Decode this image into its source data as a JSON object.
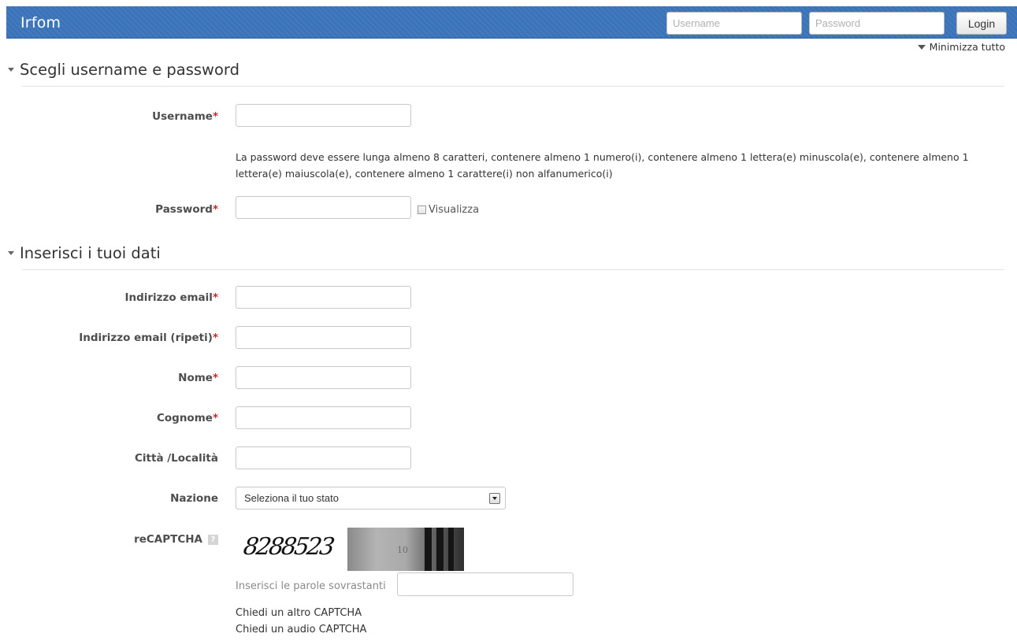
{
  "navbar": {
    "brand": "Irfom",
    "username_placeholder": "Username",
    "password_placeholder": "Password",
    "login_label": "Login",
    "accent_color": "#3b73b9"
  },
  "collapse_all_label": "Minimizza tutto",
  "sections": {
    "account": {
      "title": "Scegli username e password",
      "username_label": "Username",
      "password_help": "La password deve essere lunga almeno 8 caratteri, contenere almeno 1 numero(i), contenere almeno 1 lettera(e) minuscola(e), contenere almeno 1 lettera(e) maiuscola(e), contenere almeno 1 carattere(i) non alfanumerico(i)",
      "password_label": "Password",
      "show_password_label": "Visualizza"
    },
    "details": {
      "title": "Inserisci i tuoi dati",
      "email_label": "Indirizzo email",
      "email_repeat_label": "Indirizzo email (ripeti)",
      "firstname_label": "Nome",
      "lastname_label": "Cognome",
      "city_label": "Città /Località",
      "country_label": "Nazione",
      "country_selected": "Seleziona il tuo stato",
      "recaptcha_label": "reCAPTCHA",
      "recaptcha_help_icon": "?",
      "captcha_word": "8288523",
      "captcha_photo_text": "10",
      "captcha_prompt": "Inserisci le parole sovrastanti",
      "captcha_new_link": "Chiedi un altro CAPTCHA",
      "captcha_audio_link": "Chiedi un audio CAPTCHA"
    }
  },
  "required_marker": "*",
  "colors": {
    "required": "#c32a2a",
    "label": "#4d4d4d"
  }
}
